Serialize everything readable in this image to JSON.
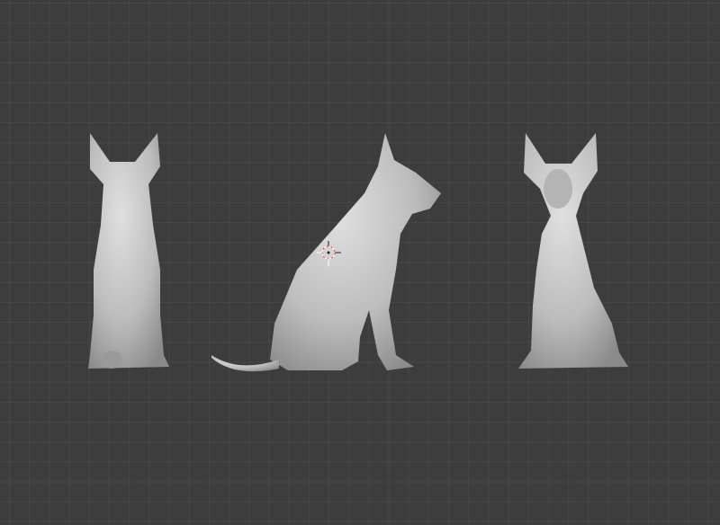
{
  "viewport": {
    "background_color": "#3d3d3d",
    "grid_color": "#474747",
    "model_color": "#c8c8c8"
  },
  "objects": [
    {
      "name": "dog-back-view",
      "icon": "sculpt-mesh"
    },
    {
      "name": "dog-side-view",
      "icon": "sculpt-mesh"
    },
    {
      "name": "dog-front-view",
      "icon": "sculpt-mesh"
    }
  ],
  "cursor": {
    "icon": "3d-cursor-icon"
  }
}
